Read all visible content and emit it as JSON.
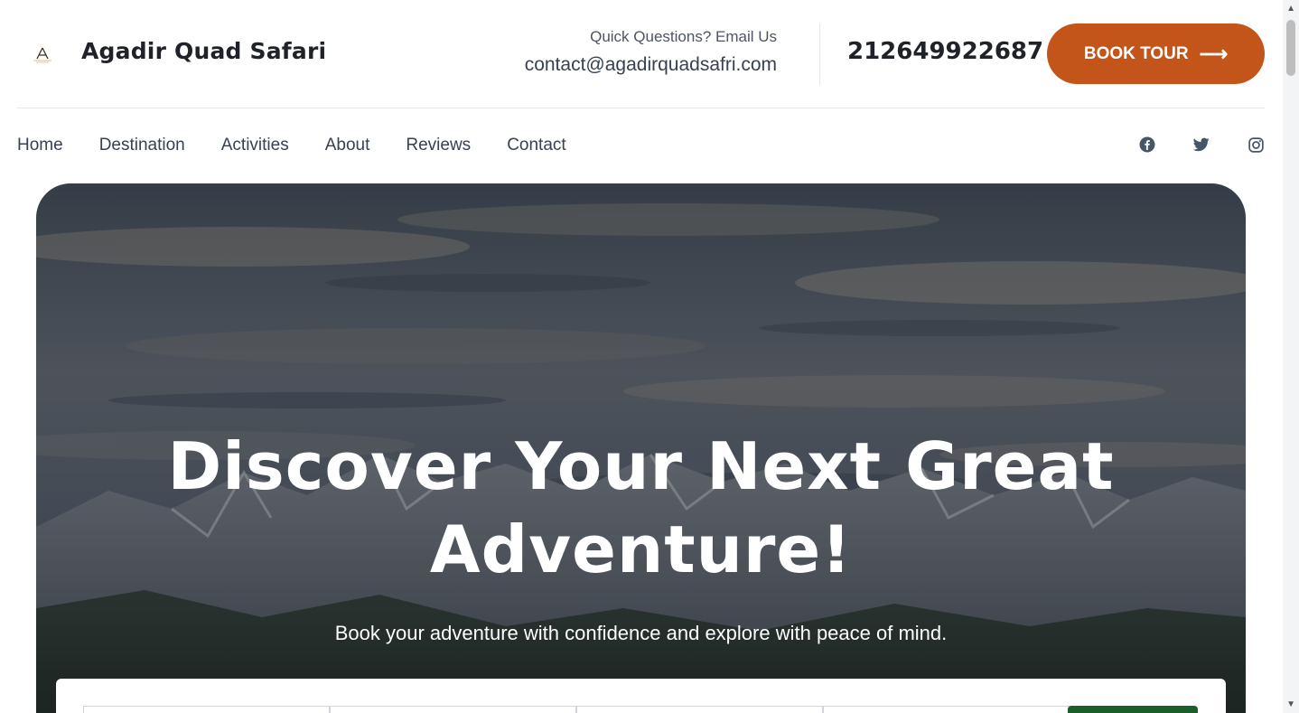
{
  "header": {
    "brand": "Agadir Quad Safari",
    "contact_question": "Quick Questions? Email Us",
    "contact_email": "contact@agadirquadsafri.com",
    "phone": "212649922687",
    "book_label": "BOOK TOUR",
    "book_arrow": "⟶"
  },
  "nav": {
    "items": [
      {
        "label": "Home"
      },
      {
        "label": "Destination"
      },
      {
        "label": "Activities"
      },
      {
        "label": "About"
      },
      {
        "label": "Reviews"
      },
      {
        "label": "Contact"
      }
    ],
    "social": [
      "facebook-icon",
      "twitter-icon",
      "instagram-icon"
    ]
  },
  "hero": {
    "title_line1": "Discover Your Next Great",
    "title_line2": "Adventure!",
    "subtitle": "Book your adventure with confidence and explore with peace of mind."
  },
  "colors": {
    "accent": "#c4551a",
    "search_button": "#1b5e2a",
    "text_dark": "#1f2329"
  }
}
